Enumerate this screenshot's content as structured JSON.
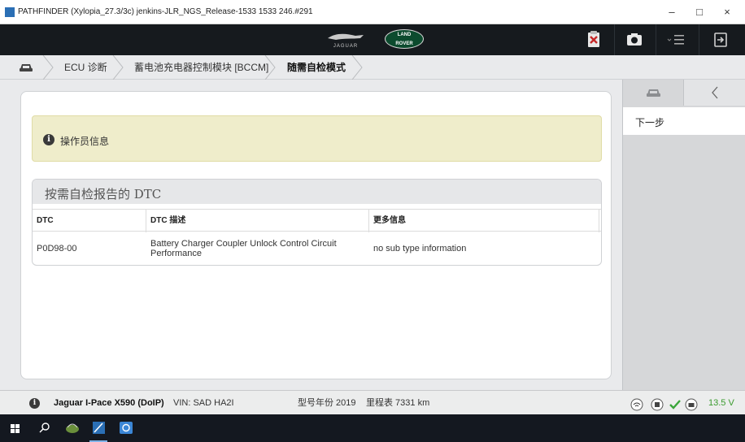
{
  "window": {
    "title": "PATHFINDER (Xylopia_27.3/3c) jenkins-JLR_NGS_Release-1533 1533 246.#291",
    "minimize": "–",
    "maximize": "□",
    "close": "×"
  },
  "header": {
    "jaguar_logo_text": "JAGUAR",
    "landrover_logo_line1": "LAND",
    "landrover_logo_line2": "ROVER",
    "icons": [
      "jaguar-logo",
      "land-rover-logo",
      "clipboard-icon",
      "camera-icon",
      "menu-icon",
      "exit-icon"
    ]
  },
  "breadcrumb": {
    "home_icon": "car-icon",
    "items": [
      {
        "label": "ECU 诊断"
      },
      {
        "label": "蓄电池充电器控制模块 [BCCM]"
      },
      {
        "label": "随需自检模式"
      }
    ]
  },
  "info": {
    "icon": "info-icon",
    "text": "操作员信息"
  },
  "dtc": {
    "title": "按需自检报告的 DTC",
    "columns": [
      "DTC",
      "DTC 描述",
      "更多信息"
    ],
    "rows": [
      {
        "code": "P0D98-00",
        "description": "Battery Charger Coupler Unlock Control Circuit Performance",
        "more": "no sub type information"
      }
    ]
  },
  "right_panel": {
    "tabs": [
      "car-icon",
      "back-icon"
    ],
    "back_glyph": "<",
    "next_step": "下一步"
  },
  "status": {
    "vehicle": "Jaguar I-Pace X590 (DoIP)",
    "vin": "VIN: SAD HA2I",
    "model_year": "型号年份 2019",
    "odometer": "里程表 7331 km",
    "voltage": "13.5 V",
    "icons": [
      "info-icon",
      "wifi-icon",
      "ecu-icon",
      "check-icon",
      "battery-icon"
    ]
  },
  "colors": {
    "header_bg": "#161a1e",
    "info_bg": "#efedcb",
    "voltage_green": "#3a9b2e",
    "check_green": "#3aa63a"
  }
}
